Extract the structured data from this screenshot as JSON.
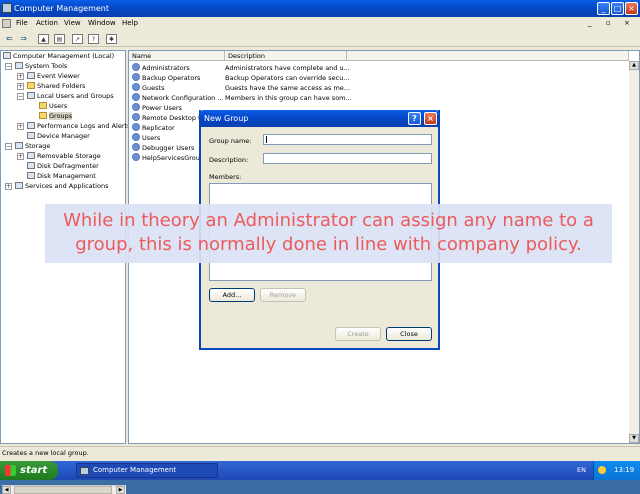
{
  "window": {
    "title": "Computer Management"
  },
  "menu": [
    "File",
    "Action",
    "View",
    "Window",
    "Help"
  ],
  "tree": {
    "root": "Computer Management (Local)",
    "system_tools": "System Tools",
    "event_viewer": "Event Viewer",
    "shared_folders": "Shared Folders",
    "local_users_groups": "Local Users and Groups",
    "users": "Users",
    "groups": "Groups",
    "perf_logs": "Performance Logs and Alerts",
    "device_manager": "Device Manager",
    "storage": "Storage",
    "removable_storage": "Removable Storage",
    "disk_defrag": "Disk Defragmenter",
    "disk_mgmt": "Disk Management",
    "services_apps": "Services and Applications"
  },
  "list": {
    "col_name": "Name",
    "col_desc": "Description",
    "rows": [
      {
        "name": "Administrators",
        "desc": "Administrators have complete and u..."
      },
      {
        "name": "Backup Operators",
        "desc": "Backup Operators can override secu..."
      },
      {
        "name": "Guests",
        "desc": "Guests have the same access as me..."
      },
      {
        "name": "Network Configuration ...",
        "desc": "Members in this group can have som..."
      },
      {
        "name": "Power Users",
        "desc": ""
      },
      {
        "name": "Remote Desktop Us",
        "desc": ""
      },
      {
        "name": "Replicator",
        "desc": ""
      },
      {
        "name": "Users",
        "desc": ""
      },
      {
        "name": "Debugger Users",
        "desc": ""
      },
      {
        "name": "HelpServicesGroup",
        "desc": ""
      }
    ]
  },
  "status": "Creates a new local group.",
  "dialog": {
    "title": "New Group",
    "group_name_label": "Group name:",
    "description_label": "Description:",
    "members_label": "Members:",
    "add": "Add...",
    "remove": "Remove",
    "create": "Create",
    "close": "Close"
  },
  "caption": "While in theory an Administrator can assign any name to a group, this is normally done in line with company policy.",
  "taskbar": {
    "start": "start",
    "task": "Computer Management",
    "lang": "EN",
    "clock": "13:19"
  }
}
